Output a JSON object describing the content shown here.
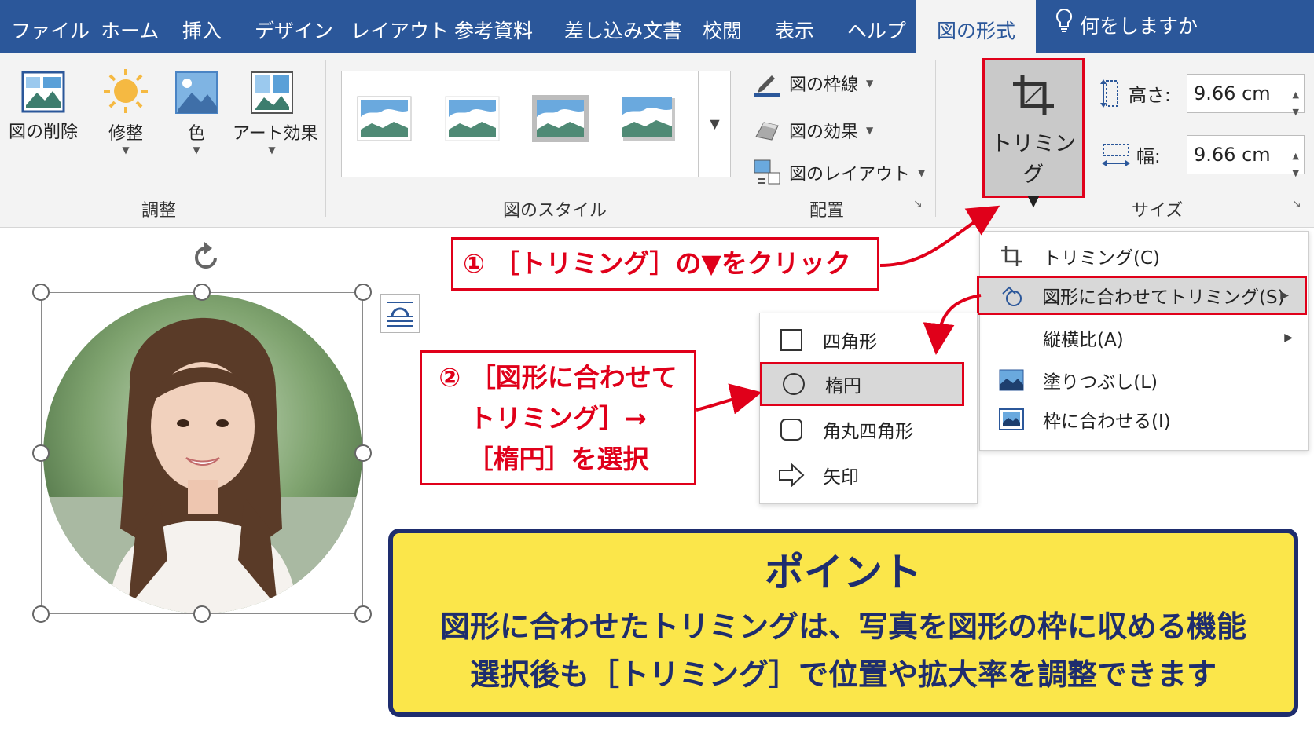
{
  "tabs": [
    "ファイル",
    "ホーム",
    "挿入",
    "デザイン",
    "レイアウト",
    "参考資料",
    "差し込み文書",
    "校閲",
    "表示",
    "ヘルプ",
    "図の形式"
  ],
  "active_tab": "図の形式",
  "tell_me": "何をしますか",
  "adjust_group": {
    "remove_bg": "図の削除",
    "corrections": "修整",
    "color": "色",
    "art_effects": "アート効果",
    "label": "調整"
  },
  "styles_group": {
    "label": "図のスタイル"
  },
  "arrange_group": {
    "border": "図の枠線",
    "effects": "図の効果",
    "layout": "図のレイアウト",
    "label": "配置"
  },
  "crop_button": {
    "label": "トリミング",
    "arrow": "▼"
  },
  "size_group": {
    "height_label": "高さ:",
    "height_value": "9.66 cm",
    "width_label": "幅:",
    "width_value": "9.66 cm",
    "label": "サイズ"
  },
  "crop_menu": {
    "crop": "トリミング(C)",
    "fit_to_shape": "図形に合わせてトリミング(S)",
    "aspect_ratio": "縦横比(A)",
    "fill": "塗りつぶし(L)",
    "fit": "枠に合わせる(I)"
  },
  "shape_menu": {
    "rectangle": "四角形",
    "ellipse": "楕円",
    "rounded_rectangle": "角丸四角形",
    "arrow": "矢印"
  },
  "callouts": {
    "step1": "① ［トリミング］の▼をクリック",
    "step2_line1": "② ［図形に合わせて",
    "step2_line2": "トリミング］→",
    "step2_line3": "［楕円］を選択"
  },
  "point": {
    "title": "ポイント",
    "line1": "図形に合わせたトリミングは、写真を図形の枠に収める機能",
    "line2": "選択後も［トリミング］で位置や拡大率を調整できます"
  },
  "colors": {
    "ribbon_blue": "#2b579a",
    "accent_red": "#e0001a",
    "point_yellow": "#fbe64a",
    "point_navy": "#1e2d6e"
  }
}
